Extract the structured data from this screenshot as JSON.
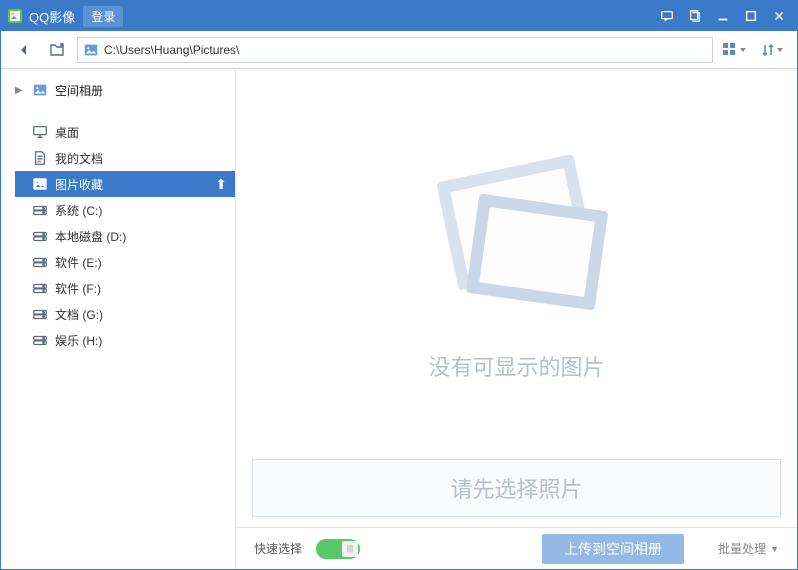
{
  "titlebar": {
    "app_name": "QQ影像",
    "login_label": "登录"
  },
  "toolbar": {
    "path": "C:\\Users\\Huang\\Pictures\\"
  },
  "sidebar": {
    "root_label": "空间相册",
    "items": [
      {
        "label": "桌面",
        "icon": "desktop"
      },
      {
        "label": "我的文档",
        "icon": "doc"
      },
      {
        "label": "图片收藏",
        "icon": "pictures",
        "selected": true
      },
      {
        "label": "系统 (C:)",
        "icon": "drive"
      },
      {
        "label": "本地磁盘 (D:)",
        "icon": "drive"
      },
      {
        "label": "软件 (E:)",
        "icon": "drive"
      },
      {
        "label": "软件 (F:)",
        "icon": "drive"
      },
      {
        "label": "文档 (G:)",
        "icon": "drive"
      },
      {
        "label": "娱乐 (H:)",
        "icon": "drive"
      }
    ]
  },
  "content": {
    "empty_text": "没有可显示的图片",
    "select_prompt": "请先选择照片"
  },
  "actions": {
    "quick_select_label": "快速选择",
    "upload_label": "上传到空间相册",
    "batch_label": "批量处理"
  }
}
